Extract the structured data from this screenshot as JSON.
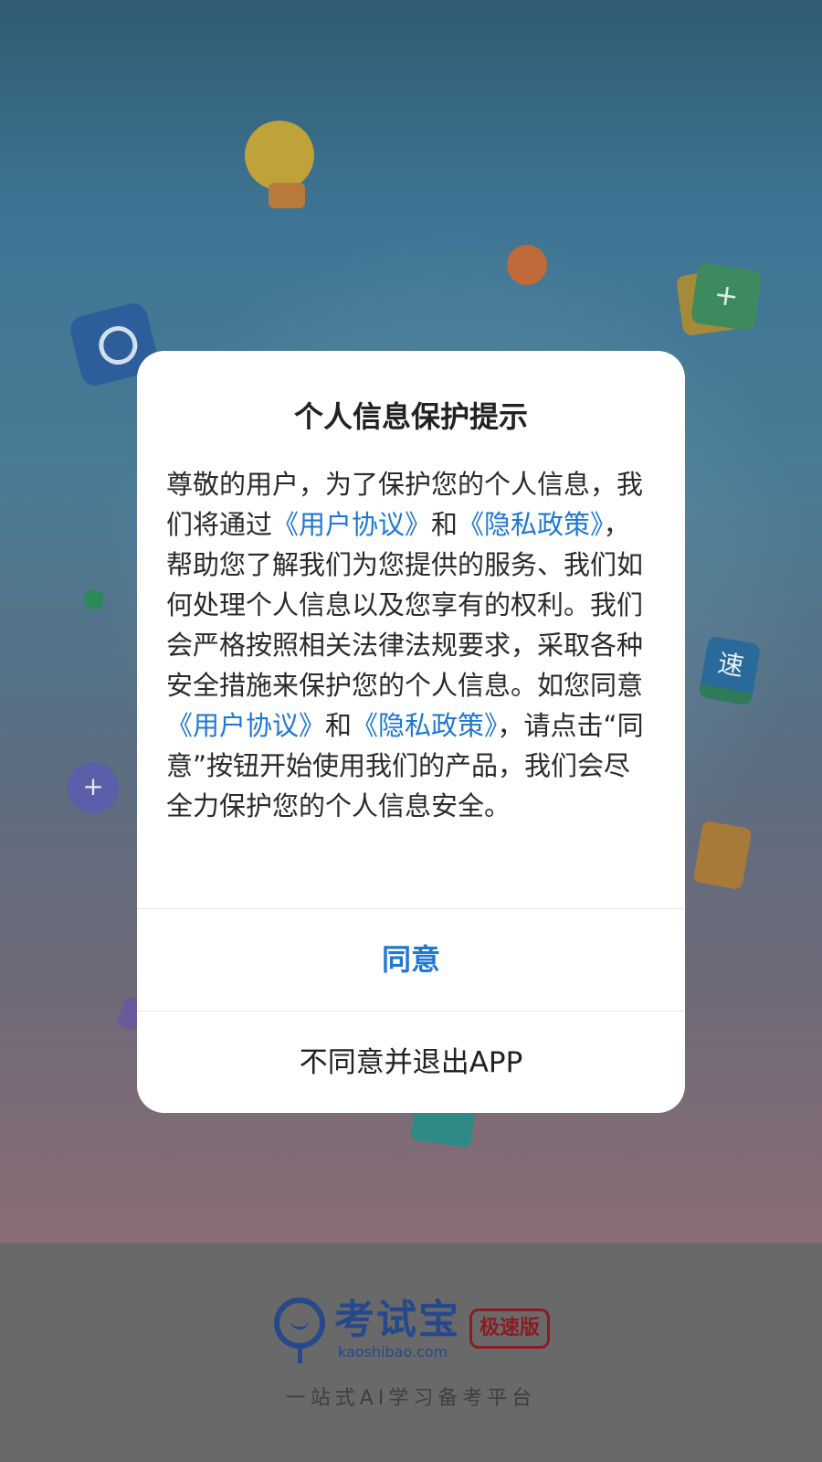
{
  "dialog": {
    "title": "个人信息保护提示",
    "body": {
      "t1": "尊敬的用户，为了保护您的个人信息，我们将通过",
      "link_user_agreement_1": "《用户协议》",
      "t2": "和",
      "link_privacy_policy_1": "《隐私政策》",
      "t3": "，帮助您了解我们为您提供的服务、我们如何处理个人信息以及您享有的权利。我们会严格按照相关法律法规要求，采取各种安全措施来保护您的个人信息。如您同意",
      "link_user_agreement_2": "《用户协议》",
      "t4": "和",
      "link_privacy_policy_2": "《隐私政策》",
      "t5": "，请点击“同意”按钮开始使用我们的产品，我们会尽全力保护您的个人信息安全。"
    },
    "agree_label": "同意",
    "disagree_label": "不同意并退出APP"
  },
  "footer": {
    "brand_name": "考试宝",
    "brand_domain": "kaoshibao.com",
    "badge": "极速版",
    "slogan": "一站式AI学习备考平台"
  },
  "decorations": {
    "plus_glyph": "+",
    "ai_glyph": "+",
    "speed_glyph": "速"
  },
  "colors": {
    "link": "#1f78d4",
    "brand": "#27498a",
    "badge": "#8a1c22"
  }
}
